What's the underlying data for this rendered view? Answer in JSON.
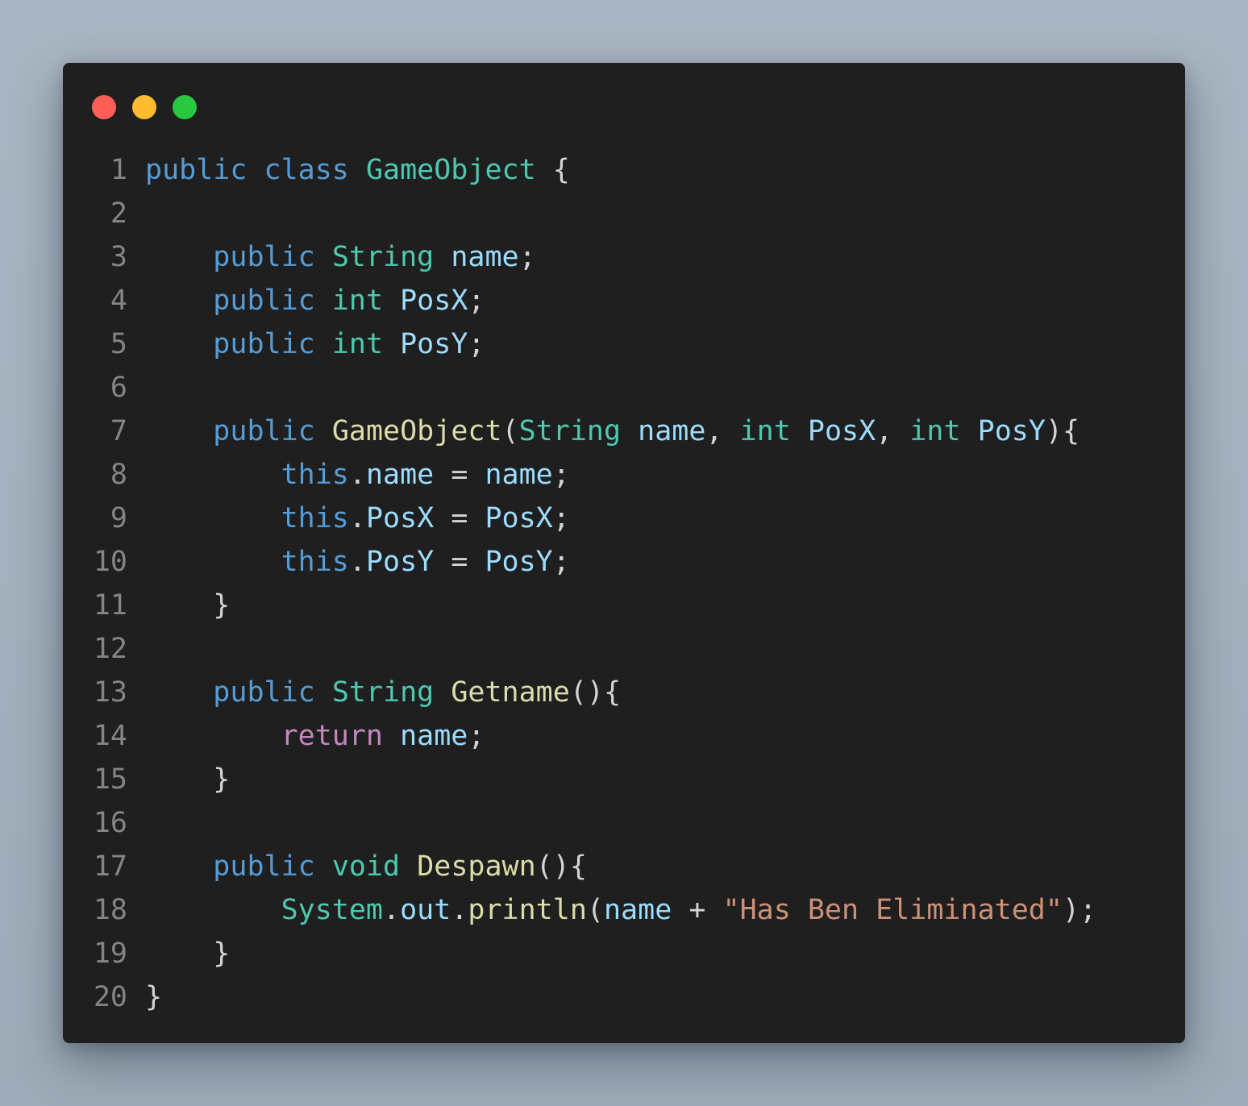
{
  "window": {
    "controls": [
      {
        "name": "close",
        "color": "#ff5f57"
      },
      {
        "name": "minimize",
        "color": "#febc2e"
      },
      {
        "name": "zoom",
        "color": "#28c840"
      }
    ]
  },
  "theme": {
    "keyword": "#569cd6",
    "type": "#4ec9b0",
    "variable": "#9cdcfe",
    "function": "#dcdcaa",
    "control": "#c586c0",
    "string": "#ce9178",
    "plain": "#d4d4d4",
    "line_number": "#858585",
    "background": "#1f1f1f"
  },
  "code": {
    "language": "java",
    "lines": [
      {
        "num": "1",
        "tokens": [
          {
            "t": "public",
            "c": "keyword"
          },
          {
            "t": " "
          },
          {
            "t": "class",
            "c": "keyword"
          },
          {
            "t": " "
          },
          {
            "t": "GameObject",
            "c": "type"
          },
          {
            "t": " {"
          }
        ]
      },
      {
        "num": "2",
        "tokens": []
      },
      {
        "num": "3",
        "tokens": [
          {
            "t": "    "
          },
          {
            "t": "public",
            "c": "keyword"
          },
          {
            "t": " "
          },
          {
            "t": "String",
            "c": "type"
          },
          {
            "t": " "
          },
          {
            "t": "name",
            "c": "variable"
          },
          {
            "t": ";"
          }
        ]
      },
      {
        "num": "4",
        "tokens": [
          {
            "t": "    "
          },
          {
            "t": "public",
            "c": "keyword"
          },
          {
            "t": " "
          },
          {
            "t": "int",
            "c": "type"
          },
          {
            "t": " "
          },
          {
            "t": "PosX",
            "c": "variable"
          },
          {
            "t": ";"
          }
        ]
      },
      {
        "num": "5",
        "tokens": [
          {
            "t": "    "
          },
          {
            "t": "public",
            "c": "keyword"
          },
          {
            "t": " "
          },
          {
            "t": "int",
            "c": "type"
          },
          {
            "t": " "
          },
          {
            "t": "PosY",
            "c": "variable"
          },
          {
            "t": ";"
          }
        ]
      },
      {
        "num": "6",
        "tokens": []
      },
      {
        "num": "7",
        "tokens": [
          {
            "t": "    "
          },
          {
            "t": "public",
            "c": "keyword"
          },
          {
            "t": " "
          },
          {
            "t": "GameObject",
            "c": "function"
          },
          {
            "t": "("
          },
          {
            "t": "String",
            "c": "type"
          },
          {
            "t": " "
          },
          {
            "t": "name",
            "c": "variable"
          },
          {
            "t": ", "
          },
          {
            "t": "int",
            "c": "type"
          },
          {
            "t": " "
          },
          {
            "t": "PosX",
            "c": "variable"
          },
          {
            "t": ", "
          },
          {
            "t": "int",
            "c": "type"
          },
          {
            "t": " "
          },
          {
            "t": "PosY",
            "c": "variable"
          },
          {
            "t": "){"
          }
        ]
      },
      {
        "num": "8",
        "tokens": [
          {
            "t": "        "
          },
          {
            "t": "this",
            "c": "keyword"
          },
          {
            "t": "."
          },
          {
            "t": "name",
            "c": "variable"
          },
          {
            "t": " = "
          },
          {
            "t": "name",
            "c": "variable"
          },
          {
            "t": ";"
          }
        ]
      },
      {
        "num": "9",
        "tokens": [
          {
            "t": "        "
          },
          {
            "t": "this",
            "c": "keyword"
          },
          {
            "t": "."
          },
          {
            "t": "PosX",
            "c": "variable"
          },
          {
            "t": " = "
          },
          {
            "t": "PosX",
            "c": "variable"
          },
          {
            "t": ";"
          }
        ]
      },
      {
        "num": "10",
        "tokens": [
          {
            "t": "        "
          },
          {
            "t": "this",
            "c": "keyword"
          },
          {
            "t": "."
          },
          {
            "t": "PosY",
            "c": "variable"
          },
          {
            "t": " = "
          },
          {
            "t": "PosY",
            "c": "variable"
          },
          {
            "t": ";"
          }
        ]
      },
      {
        "num": "11",
        "tokens": [
          {
            "t": "    }"
          }
        ]
      },
      {
        "num": "12",
        "tokens": []
      },
      {
        "num": "13",
        "tokens": [
          {
            "t": "    "
          },
          {
            "t": "public",
            "c": "keyword"
          },
          {
            "t": " "
          },
          {
            "t": "String",
            "c": "type"
          },
          {
            "t": " "
          },
          {
            "t": "Getname",
            "c": "function"
          },
          {
            "t": "(){"
          }
        ]
      },
      {
        "num": "14",
        "tokens": [
          {
            "t": "        "
          },
          {
            "t": "return",
            "c": "control"
          },
          {
            "t": " "
          },
          {
            "t": "name",
            "c": "variable"
          },
          {
            "t": ";"
          }
        ]
      },
      {
        "num": "15",
        "tokens": [
          {
            "t": "    }"
          }
        ]
      },
      {
        "num": "16",
        "tokens": []
      },
      {
        "num": "17",
        "tokens": [
          {
            "t": "    "
          },
          {
            "t": "public",
            "c": "keyword"
          },
          {
            "t": " "
          },
          {
            "t": "void",
            "c": "type"
          },
          {
            "t": " "
          },
          {
            "t": "Despawn",
            "c": "function"
          },
          {
            "t": "(){"
          }
        ]
      },
      {
        "num": "18",
        "tokens": [
          {
            "t": "        "
          },
          {
            "t": "System",
            "c": "type"
          },
          {
            "t": "."
          },
          {
            "t": "out",
            "c": "variable"
          },
          {
            "t": "."
          },
          {
            "t": "println",
            "c": "function"
          },
          {
            "t": "("
          },
          {
            "t": "name",
            "c": "variable"
          },
          {
            "t": " + "
          },
          {
            "t": "\"Has Ben Eliminated\"",
            "c": "string"
          },
          {
            "t": ");"
          }
        ]
      },
      {
        "num": "19",
        "tokens": [
          {
            "t": "    }"
          }
        ]
      },
      {
        "num": "20",
        "tokens": [
          {
            "t": "}"
          }
        ]
      }
    ]
  }
}
